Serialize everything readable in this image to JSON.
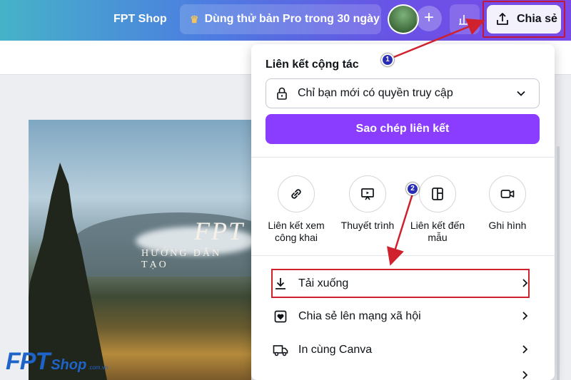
{
  "header": {
    "brand": "FPT Shop",
    "pro_button": "Dùng thử bản Pro trong 30 ngày",
    "share_button": "Chia sẻ"
  },
  "canvas": {
    "title": "FPT",
    "subtitle": "HƯỚNG DẪN TẠO"
  },
  "watermark": {
    "main": "FPT",
    "shop": "Shop",
    "domain": ".com.vn"
  },
  "share_panel": {
    "title": "Liên kết cộng tác",
    "access_select": "Chỉ bạn mới có quyền truy cập",
    "copy_button": "Sao chép liên kết",
    "options": [
      {
        "label": "Liên kết xem công khai",
        "icon": "link-icon"
      },
      {
        "label": "Thuyết trình",
        "icon": "presentation-icon"
      },
      {
        "label": "Liên kết đến mẫu",
        "icon": "template-icon"
      },
      {
        "label": "Ghi hình",
        "icon": "video-camera-icon"
      }
    ],
    "rows": [
      {
        "label": "Tải xuống",
        "icon": "download-icon"
      },
      {
        "label": "Chia sẻ lên mạng xã hội",
        "icon": "heart-icon"
      },
      {
        "label": "In cùng Canva",
        "icon": "truck-icon"
      }
    ]
  },
  "annotations": {
    "step1": "1",
    "step2": "2",
    "arrow_color": "#d0222e",
    "badge_color": "#2a2db5"
  },
  "colors": {
    "accent": "#8b3dff"
  }
}
